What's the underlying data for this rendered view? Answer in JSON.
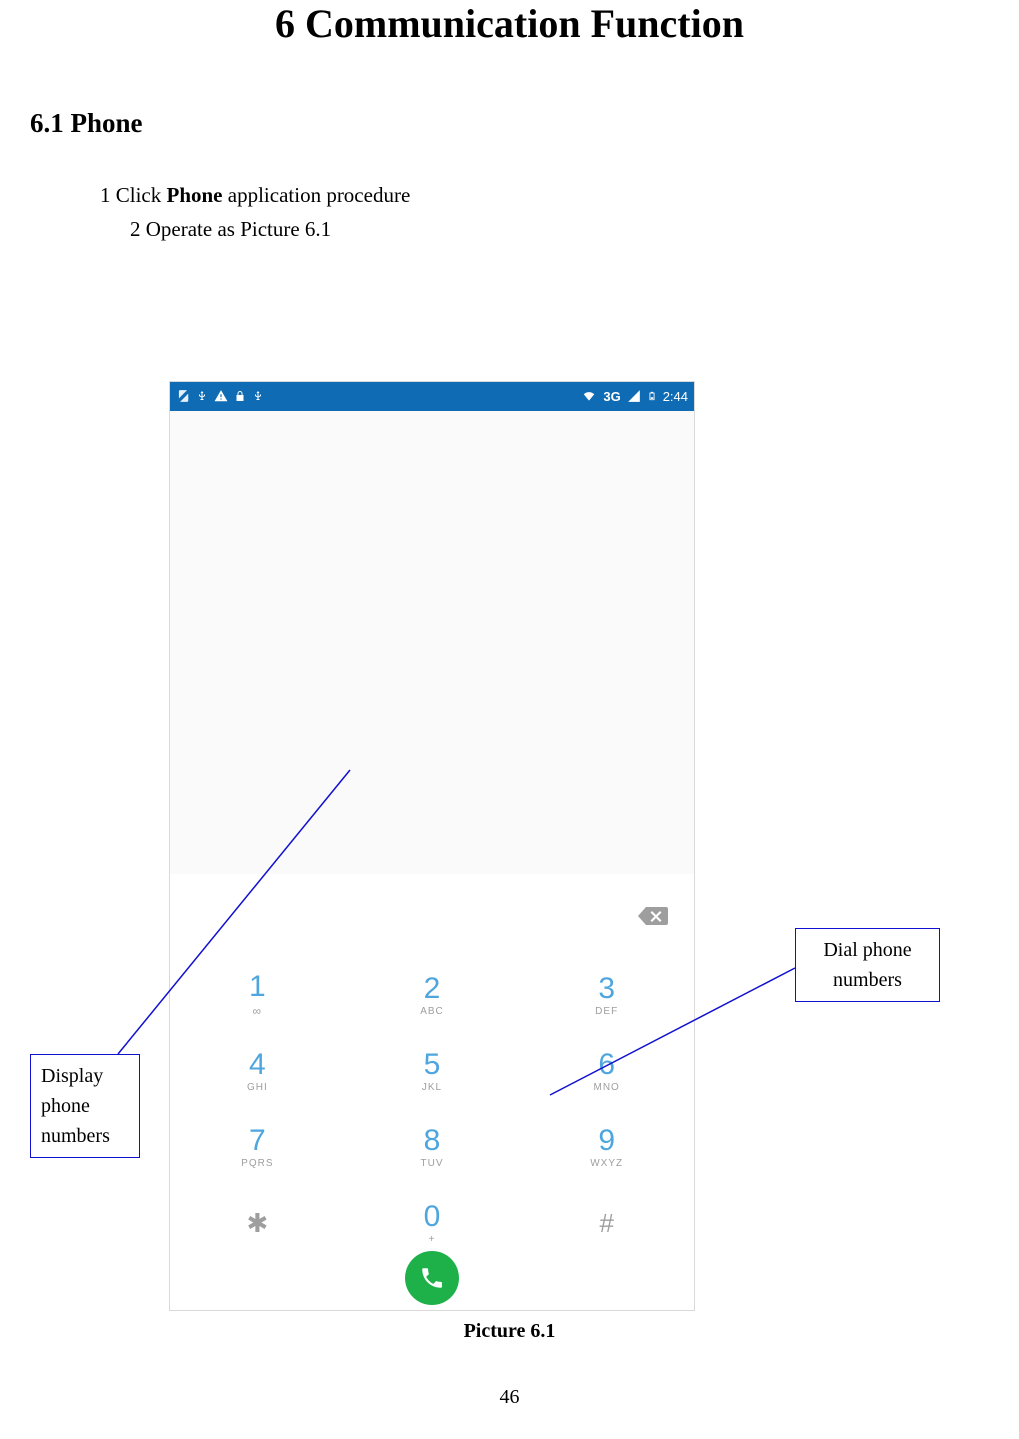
{
  "title": "6 Communication Function",
  "section": "6.1 Phone",
  "step1_pre": "1 Click ",
  "step1_bold": "Phone",
  "step1_post": " application procedure",
  "step2": "2    Operate as Picture 6.1",
  "caption": "Picture 6.1",
  "pagenum": "46",
  "callout_left": "Display phone numbers",
  "callout_right": "Dial phone numbers",
  "status": {
    "network": "3G",
    "time": "2:44"
  },
  "keys": [
    [
      {
        "n": "1",
        "s": "∞"
      },
      {
        "n": "2",
        "s": "ABC"
      },
      {
        "n": "3",
        "s": "DEF"
      }
    ],
    [
      {
        "n": "4",
        "s": "GHI"
      },
      {
        "n": "5",
        "s": "JKL"
      },
      {
        "n": "6",
        "s": "MNO"
      }
    ],
    [
      {
        "n": "7",
        "s": "PQRS"
      },
      {
        "n": "8",
        "s": "TUV"
      },
      {
        "n": "9",
        "s": "WXYZ"
      }
    ],
    [
      {
        "n": "✱",
        "s": ""
      },
      {
        "n": "0",
        "s": "+"
      },
      {
        "n": "#",
        "s": ""
      }
    ]
  ]
}
